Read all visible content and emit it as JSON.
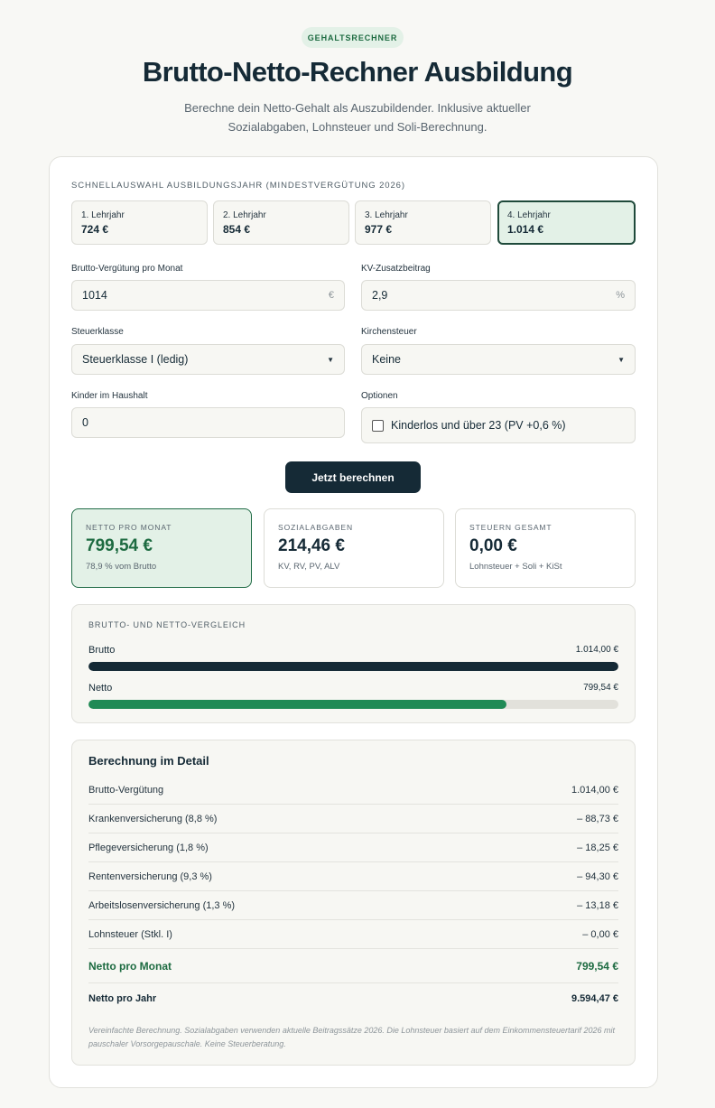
{
  "header": {
    "badge": "GEHALTSRECHNER",
    "title": "Brutto-Netto-Rechner Ausbildung",
    "subtitle": "Berechne dein Netto-Gehalt als Auszubildender. Inklusive aktueller Sozialabgaben, Lohnsteuer und Soli-Berechnung."
  },
  "quick_select": {
    "label": "SCHNELLAUSWAHL AUSBILDUNGSJAHR (MINDESTVERGÜTUNG 2026)",
    "years": [
      {
        "label": "1. Lehrjahr",
        "value": "724 €"
      },
      {
        "label": "2. Lehrjahr",
        "value": "854 €"
      },
      {
        "label": "3. Lehrjahr",
        "value": "977 €"
      },
      {
        "label": "4. Lehrjahr",
        "value": "1.014 €"
      }
    ],
    "selected_index": 3
  },
  "form": {
    "gross": {
      "label": "Brutto-Vergütung pro Monat",
      "value": "1014",
      "unit": "€"
    },
    "kv": {
      "label": "KV-Zusatzbeitrag",
      "value": "2,9",
      "unit": "%"
    },
    "tax_class": {
      "label": "Steuerklasse",
      "value": "Steuerklasse I (ledig)"
    },
    "church_tax": {
      "label": "Kirchensteuer",
      "value": "Keine"
    },
    "children": {
      "label": "Kinder im Haushalt",
      "value": "0"
    },
    "options": {
      "label": "Optionen",
      "checkbox_label": "Kinderlos und über 23 (PV +0,6 %)",
      "checked": false
    }
  },
  "calculate_button": "Jetzt berechnen",
  "results": [
    {
      "label": "NETTO PRO MONAT",
      "value": "799,54 €",
      "sub": "78,9 % vom Brutto"
    },
    {
      "label": "SOZIALABGABEN",
      "value": "214,46 €",
      "sub": "KV, RV, PV, ALV"
    },
    {
      "label": "STEUERN GESAMT",
      "value": "0,00 €",
      "sub": "Lohnsteuer + Soli + KiSt"
    }
  ],
  "comparison": {
    "label": "BRUTTO- UND NETTO-VERGLEICH",
    "bars": [
      {
        "name": "Brutto",
        "value": "1.014,00 €",
        "fraction": 1.0,
        "color": "#152a36"
      },
      {
        "name": "Netto",
        "value": "799,54 €",
        "fraction": 0.789,
        "color": "#1f8a55"
      }
    ]
  },
  "detail": {
    "title": "Berechnung im Detail",
    "rows": [
      {
        "label": "Brutto-Vergütung",
        "value": "1.014,00 €"
      },
      {
        "label": "Krankenversicherung (8,8 %)",
        "value": "– 88,73 €"
      },
      {
        "label": "Pflegeversicherung (1,8 %)",
        "value": "– 18,25 €"
      },
      {
        "label": "Rentenversicherung (9,3 %)",
        "value": "– 94,30 €"
      },
      {
        "label": "Arbeitslosenversicherung (1,3 %)",
        "value": "– 13,18 €"
      },
      {
        "label": "Lohnsteuer (Stkl. I)",
        "value": "– 0,00 €"
      }
    ],
    "net_month": {
      "label": "Netto pro Monat",
      "value": "799,54 €"
    },
    "net_year": {
      "label": "Netto pro Jahr",
      "value": "9.594,47 €"
    },
    "footnote": "Vereinfachte Berechnung. Sozialabgaben verwenden aktuelle Beitragssätze 2026. Die Lohnsteuer basiert auf dem Einkommensteuertarif 2026 mit pauschaler Vorsorgepauschale. Keine Steuerberatung."
  }
}
